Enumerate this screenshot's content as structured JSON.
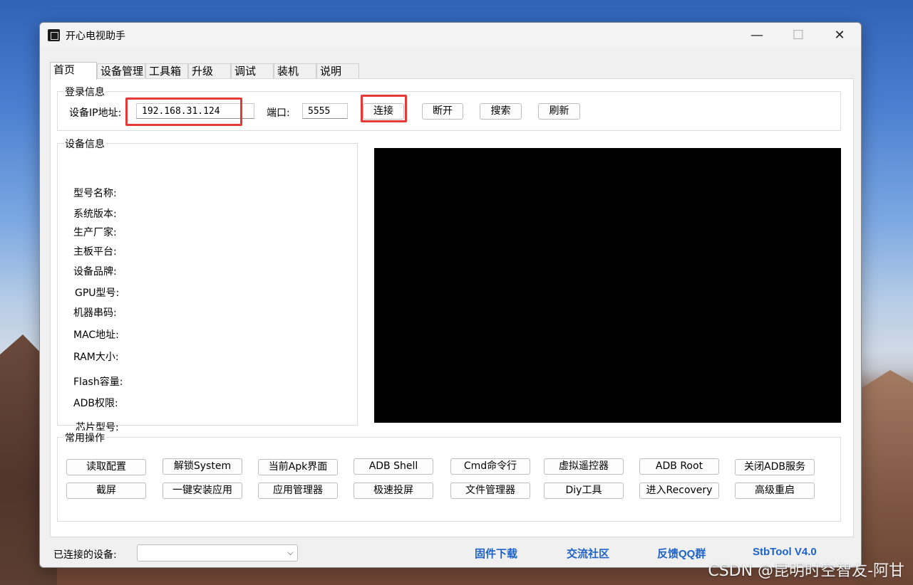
{
  "window": {
    "title": "开心电视助手",
    "minimize": "—",
    "maximize": "☐",
    "close": "✕"
  },
  "tabs": [
    {
      "label": "首页"
    },
    {
      "label": "设备管理"
    },
    {
      "label": "工具箱"
    },
    {
      "label": "升级"
    },
    {
      "label": "调试"
    },
    {
      "label": "装机"
    },
    {
      "label": "说明"
    }
  ],
  "login": {
    "group_title": "登录信息",
    "ip_label": "设备IP地址:",
    "ip_value": "192.168.31.124",
    "port_label": "端口:",
    "port_value": "5555",
    "buttons": [
      "连接",
      "断开",
      "搜索",
      "刷新"
    ]
  },
  "device_info": {
    "group_title": "设备信息",
    "fields": [
      "型号名称:",
      "系统版本:",
      "生产厂家:",
      "主板平台:",
      "设备品牌:",
      "GPU型号:",
      "机器串码:",
      "MAC地址:",
      "RAM大小:",
      "Flash容量:",
      "ADB权限:",
      "芯片型号:"
    ]
  },
  "operations": {
    "group_title": "常用操作",
    "row1": [
      "读取配置",
      "解锁System",
      "当前Apk界面",
      "ADB Shell",
      "Cmd命令行",
      "虚拟遥控器",
      "ADB  Root",
      "关闭ADB服务"
    ],
    "row2": [
      "截屏",
      "一键安装应用",
      "应用管理器",
      "极速投屏",
      "文件管理器",
      "Diy工具",
      "进入Recovery",
      "高级重启"
    ]
  },
  "statusbar": {
    "connected_label": "已连接的设备:",
    "connected_value": "",
    "links": [
      "固件下载",
      "交流社区",
      "反馈QQ群",
      "StbTool V4.0"
    ]
  },
  "watermark": "CSDN @昆明时空智友-阿甘",
  "colors": {
    "highlight": "#e53935",
    "link": "#1e62c8"
  }
}
